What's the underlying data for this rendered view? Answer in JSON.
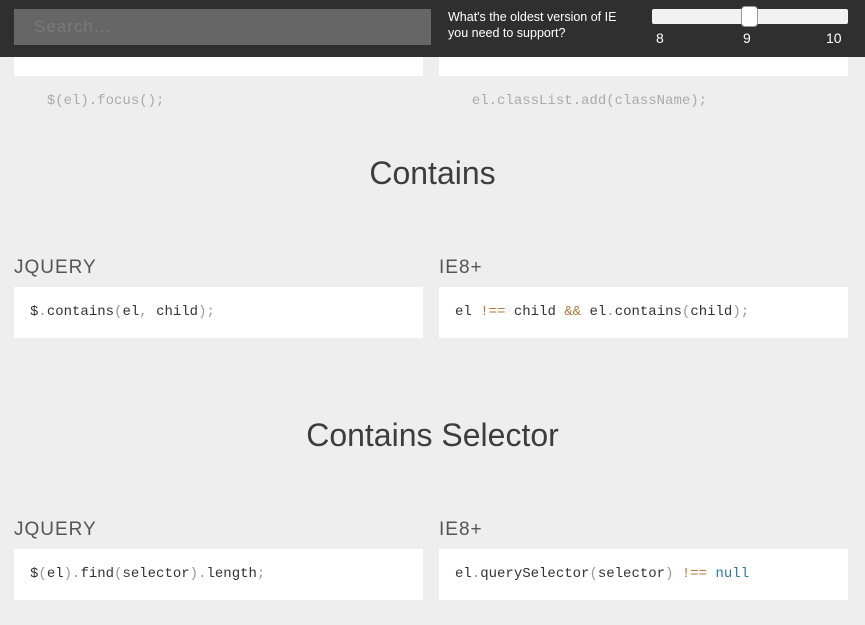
{
  "search": {
    "placeholder": "Search..."
  },
  "ie_selector": {
    "question": "What's the oldest version of IE you need to support?",
    "ticks": [
      "8",
      "9",
      "10"
    ],
    "selected": "9"
  },
  "top_partial": {
    "left_code": "$(el).focus();",
    "right_code": "el.classList.add(className);"
  },
  "sections": [
    {
      "title": "Contains",
      "left_label": "JQUERY",
      "right_label": "IE8+",
      "left_tokens": {
        "t1": "$",
        "t2": ".",
        "t3": "contains",
        "t4": "(",
        "t5": "el",
        "t6": ", ",
        "t7": "child",
        "t8": ");"
      },
      "right_tokens": {
        "t1": "el ",
        "t2": "!==",
        "t3": " child ",
        "t4": "&&",
        "t5": " el",
        "t6": ".",
        "t7": "contains",
        "t8": "(",
        "t9": "child",
        "t10": ");"
      }
    },
    {
      "title": "Contains Selector",
      "left_label": "JQUERY",
      "right_label": "IE8+",
      "left_tokens": {
        "t1": "$",
        "t2": "(",
        "t3": "el",
        "t4": ").",
        "t5": "find",
        "t6": "(",
        "t7": "selector",
        "t8": ").",
        "t9": "length",
        "t10": ";"
      },
      "right_tokens": {
        "t1": "el",
        "t2": ".",
        "t3": "querySelector",
        "t4": "(",
        "t5": "selector",
        "t6": ") ",
        "t7": "!==",
        "t8": " ",
        "t9": "null"
      }
    }
  ]
}
